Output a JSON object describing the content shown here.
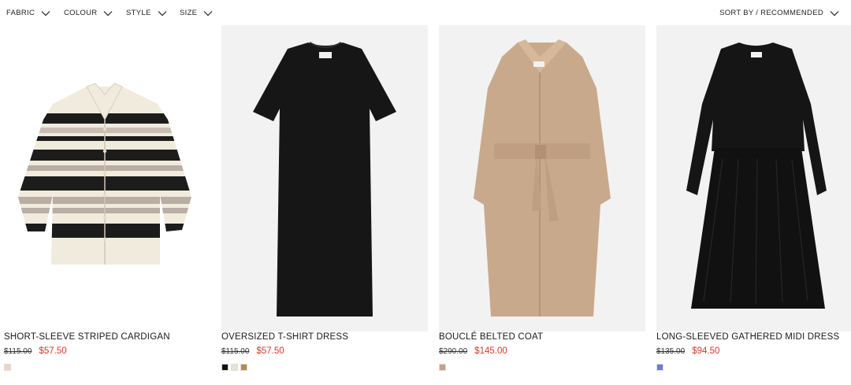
{
  "filters": {
    "fabric": "FABRIC",
    "colour": "COLOUR",
    "style": "STYLE",
    "size": "SIZE",
    "sort": "SORT BY / RECOMMENDED"
  },
  "products": [
    {
      "title": "SHORT-SLEEVE STRIPED CARDIGAN",
      "old_price": "$115.00",
      "sale_price": "$57.50",
      "swatches": [
        "#e9d6c8"
      ]
    },
    {
      "title": "OVERSIZED T-SHIRT DRESS",
      "old_price": "$115.00",
      "sale_price": "$57.50",
      "swatches": [
        "#111111",
        "#e8e2d4",
        "#b48a58"
      ]
    },
    {
      "title": "BOUCLÉ BELTED COAT",
      "old_price": "$290.00",
      "sale_price": "$145.00",
      "swatches": [
        "#c8a088"
      ]
    },
    {
      "title": "LONG-SLEEVED GATHERED MIDI DRESS",
      "old_price": "$135.00",
      "sale_price": "$94.50",
      "swatches": [
        "#6e7bd6"
      ]
    }
  ],
  "colors": {
    "sale": "#d23b2b",
    "image_bg": "#f2f2f2"
  },
  "icons": {
    "filter_chevron": "chevron-down-icon",
    "sort_chevron": "chevron-down-icon"
  }
}
